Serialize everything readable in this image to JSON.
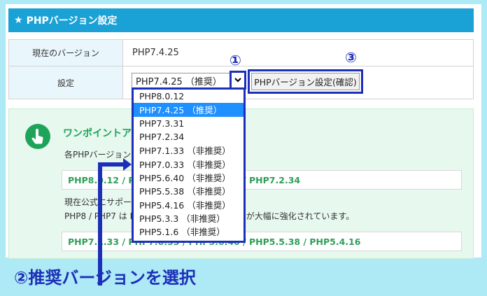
{
  "header": {
    "title": "PHPバージョン設定"
  },
  "table": {
    "current_label": "現在のバージョン",
    "current_value": "PHP7.4.25",
    "setting_label": "設定"
  },
  "select": {
    "selected": "PHP7.4.25 （推奨）",
    "options": [
      "PHP8.0.12",
      "PHP7.4.25 （推奨）",
      "PHP7.3.31",
      "PHP7.2.34",
      "PHP7.1.33 （非推奨）",
      "PHP7.0.33 （非推奨）",
      "PHP5.6.40 （非推奨）",
      "PHP5.5.38 （非推奨）",
      "PHP5.4.16 （非推奨）",
      "PHP5.3.3 （非推奨）",
      "PHP5.1.6 （非推奨）"
    ],
    "selected_index": 1
  },
  "submit_label": "PHPバージョン設定(確認)",
  "markers": {
    "one": "①",
    "three": "③"
  },
  "tip": {
    "title": "ワンポイントア",
    "line1": "各PHPバージョン",
    "bar1": "PHP8.0.12 / PHP7.4.25 / PHP7.3.31 / PHP7.2.34",
    "line3": "現在公式にサポートされているバージョンです。",
    "line4": "PHP8 / PHP7 は PHP5 と比べてパフォーマンスが大幅に強化されています。",
    "bar2": "PHP7.1.33 / PHP7.0.33 / PHP5.6.40 / PHP5.5.38 / PHP5.4.16"
  },
  "caption": "②推奨バージョンを選択",
  "colors": {
    "accent": "#1c2fb8",
    "header": "#1aa1d6",
    "tip_green": "#1ea45a",
    "selected_option": "#1e90ff"
  }
}
